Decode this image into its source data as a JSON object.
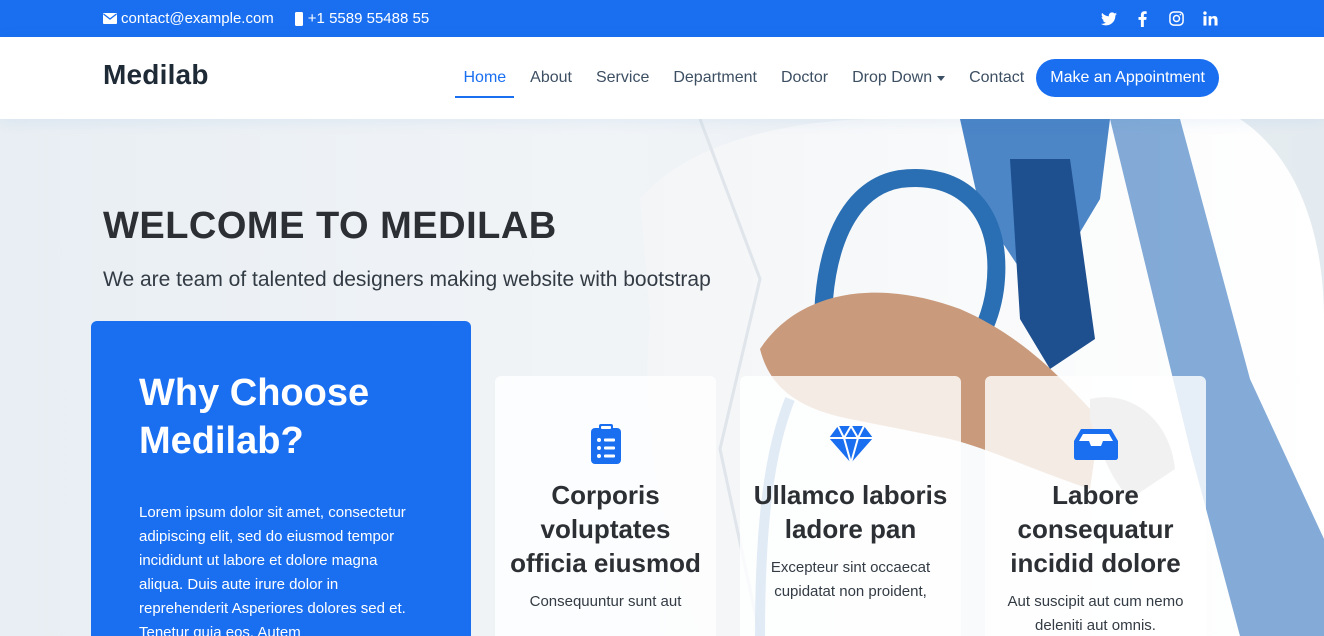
{
  "topbar": {
    "email": "contact@example.com",
    "phone": "+1 5589 55488 55",
    "social": [
      "twitter-icon",
      "facebook-icon",
      "instagram-icon",
      "linkedin-icon"
    ]
  },
  "header": {
    "logo": "Medilab",
    "nav": {
      "home": "Home",
      "about": "About",
      "service": "Service",
      "department": "Department",
      "doctor": "Doctor",
      "dropdown": "Drop Down",
      "contact": "Contact"
    },
    "cta": "Make an Appointment"
  },
  "hero": {
    "title": "WELCOME TO MEDILAB",
    "subtitle": "We are team of talented designers making website with bootstrap"
  },
  "why": {
    "title": "Why Choose Medilab?",
    "text": "Lorem ipsum dolor sit amet, consectetur adipiscing elit, sed do eiusmod tempor incididunt ut labore et dolore magna aliqua. Duis aute irure dolor in reprehenderit Asperiores dolores sed et. Tenetur quia eos. Autem"
  },
  "cards": [
    {
      "icon": "clipboard-icon",
      "title": "Corporis voluptates officia eiusmod",
      "text": "Consequuntur sunt aut"
    },
    {
      "icon": "gem-icon",
      "title": "Ullamco laboris ladore pan",
      "text": "Excepteur sint occaecat cupidatat non proident,"
    },
    {
      "icon": "inbox-icon",
      "title": "Labore consequatur incidid dolore",
      "text": "Aut suscipit aut cum nemo deleniti aut omnis."
    }
  ],
  "colors": {
    "primary": "#1a6ff0",
    "heading": "#2c2f33"
  }
}
